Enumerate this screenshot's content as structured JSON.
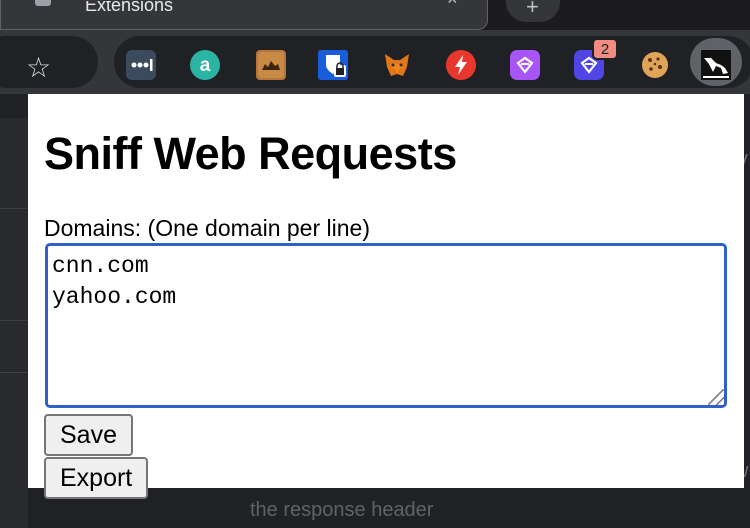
{
  "browser": {
    "tab_title": "Extensions",
    "tab_close_glyph": "×",
    "new_tab_glyph": "+",
    "star_glyph": "☆",
    "extensions": [
      {
        "icon": "password-manager-dots-icon"
      },
      {
        "icon": "a-circle-icon"
      },
      {
        "icon": "camel-icon"
      },
      {
        "icon": "bitwarden-shield-icon"
      },
      {
        "icon": "metamask-fox-icon"
      },
      {
        "icon": "lightning-icon"
      },
      {
        "icon": "purple-tag-icon"
      },
      {
        "icon": "blue-tag-icon"
      },
      {
        "icon": "cookie-icon"
      },
      {
        "icon": "sniff-dog-icon"
      }
    ],
    "badge_count": "2"
  },
  "popup": {
    "title": "Sniff Web Requests",
    "domains_label": "Domains: (One domain per line)",
    "domains_value": "cnn.com\nyahoo.com",
    "save_label": "Save",
    "export_label": "Export"
  },
  "background_page": {
    "footer_text": "the response header",
    "glyph_right_top": "v",
    "glyph_right_bottom": "w"
  },
  "colors": {
    "chrome_dark": "#202124",
    "toolbar": "#35363a",
    "focus_ring": "#2e62c9",
    "badge": "#f28b82"
  }
}
